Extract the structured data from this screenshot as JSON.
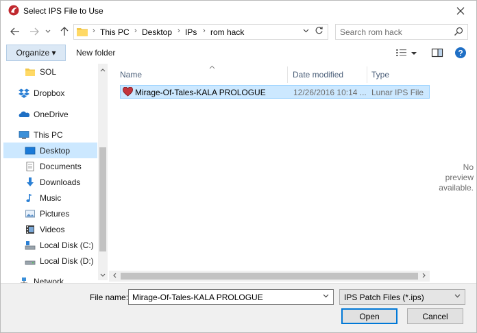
{
  "window": {
    "title": "Select IPS File to Use"
  },
  "nav": {
    "breadcrumb": [
      "This PC",
      "Desktop",
      "IPs",
      "rom hack"
    ],
    "search_placeholder": "Search rom hack"
  },
  "toolbar": {
    "organize_label": "Organize ▾",
    "new_folder_label": "New folder"
  },
  "sidebar": {
    "items": [
      {
        "label": "SOL",
        "icon": "folder-icon"
      },
      {
        "label": "Dropbox",
        "icon": "dropbox-icon"
      },
      {
        "label": "OneDrive",
        "icon": "onedrive-icon"
      },
      {
        "label": "This PC",
        "icon": "computer-icon"
      },
      {
        "label": "Desktop",
        "icon": "desktop-icon",
        "selected": true
      },
      {
        "label": "Documents",
        "icon": "documents-icon"
      },
      {
        "label": "Downloads",
        "icon": "downloads-icon"
      },
      {
        "label": "Music",
        "icon": "music-icon"
      },
      {
        "label": "Pictures",
        "icon": "pictures-icon"
      },
      {
        "label": "Videos",
        "icon": "videos-icon"
      },
      {
        "label": "Local Disk (C:)",
        "icon": "drive-c-icon"
      },
      {
        "label": "Local Disk (D:)",
        "icon": "drive-d-icon"
      },
      {
        "label": "Network",
        "icon": "network-icon"
      }
    ]
  },
  "filelist": {
    "columns": [
      "Name",
      "Date modified",
      "Type"
    ],
    "rows": [
      {
        "name": "Mirage-Of-Tales-KALA PROLOGUE",
        "date": "12/26/2016 10:14 ...",
        "type": "Lunar IPS File"
      }
    ]
  },
  "preview": {
    "line1": "No preview",
    "line2": "available."
  },
  "footer": {
    "filename_label": "File name:",
    "filename_value": "Mirage-Of-Tales-KALA PROLOGUE",
    "filetype_value": "IPS Patch Files (*.ips)",
    "open_label": "Open",
    "cancel_label": "Cancel"
  },
  "colors": {
    "selection": "#cce8ff",
    "selection_border": "#99d1ff",
    "accent": "#0078d7",
    "header_text": "#4c607a"
  }
}
